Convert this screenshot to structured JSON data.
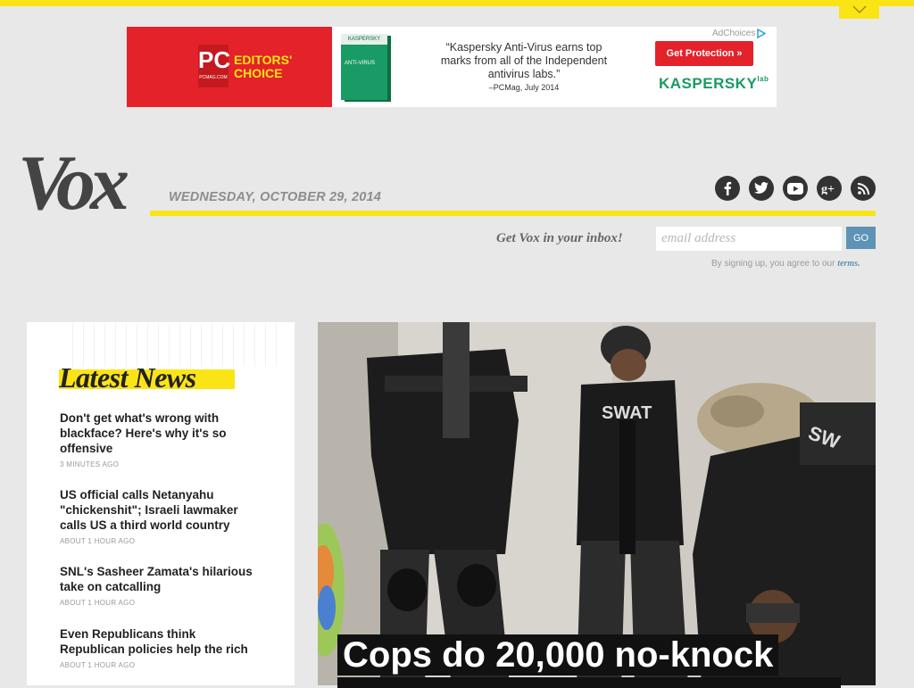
{
  "ad": {
    "pc_logo": "PC",
    "pc_sub": "PCMAG.COM",
    "editors_choice": "EDITORS' CHOICE",
    "product_box_brand": "KASPERSKY",
    "product_box_name": "ANTI-VIRUS",
    "quote": "“Kaspersky Anti-Virus earns top marks from all of the Independent antivirus labs.”",
    "quote_source": "–PCMag, July 2014",
    "cta": "Get Protection »",
    "brand": "KASPERSKY",
    "brand_suffix": "lab",
    "ad_choices": "AdChoices",
    "colors": {
      "red": "#e3222a",
      "green": "#1a9a64"
    }
  },
  "masthead": {
    "logo": "Vox",
    "date": "WEDNESDAY, OCTOBER 29, 2014",
    "accent_color": "#fbe416",
    "social": [
      {
        "name": "facebook-icon",
        "glyph": "f"
      },
      {
        "name": "twitter-icon",
        "glyph": "t"
      },
      {
        "name": "youtube-icon",
        "glyph": "yt"
      },
      {
        "name": "google-plus-icon",
        "glyph": "g+"
      },
      {
        "name": "rss-icon",
        "glyph": "rss"
      }
    ]
  },
  "newsletter": {
    "label": "Get Vox in your inbox!",
    "placeholder": "email address",
    "button": "GO",
    "terms_prefix": "By signing up, you agree to our",
    "terms_link": "terms."
  },
  "latest_news": {
    "title": "Latest News",
    "items": [
      {
        "title": "Don't get what's wrong with blackface? Here's why it's so offensive",
        "time": "3 MINUTES AGO"
      },
      {
        "title": "US official calls Netanyahu \"chickenshit\"; Israeli lawmaker calls US a third world country",
        "time": "ABOUT 1 HOUR AGO"
      },
      {
        "title": "SNL's Sasheer Zamata's hilarious take on catcalling",
        "time": "ABOUT 1 HOUR AGO"
      },
      {
        "title": "Even Republicans think Republican policies help the rich",
        "time": "ABOUT 1 HOUR AGO"
      }
    ]
  },
  "hero": {
    "headline": "Cops do 20,000 no-knock",
    "vest_text": "SWAT"
  }
}
